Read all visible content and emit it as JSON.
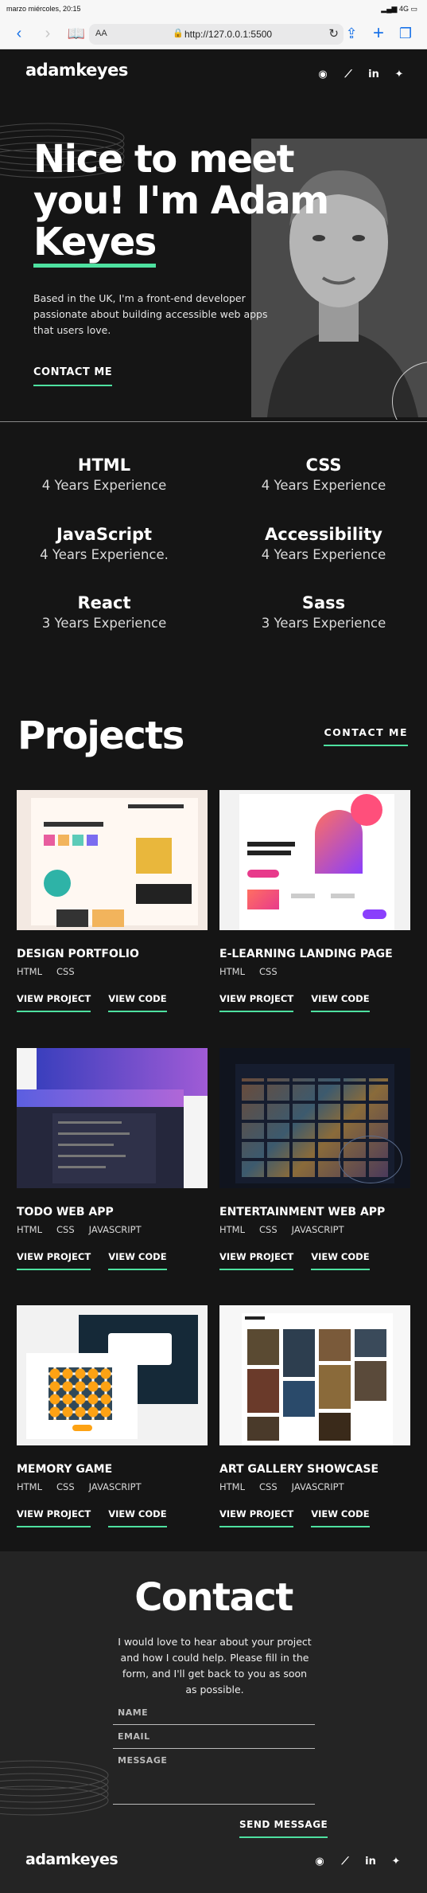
{
  "status": {
    "time": "marzo miércoles, 20:15",
    "signal": "4G"
  },
  "browser": {
    "aa": "AA",
    "url": "http://127.0.0.1:5500"
  },
  "header": {
    "logo": "adamkeyes",
    "socials": [
      {
        "icon": "github-icon",
        "glyph": "◉"
      },
      {
        "icon": "frontendmentor-icon",
        "glyph": "⟋"
      },
      {
        "icon": "linkedin-icon",
        "glyph": "in"
      },
      {
        "icon": "twitter-icon",
        "glyph": "✦"
      }
    ]
  },
  "hero": {
    "title_line1": "Nice to meet",
    "title_line2": "you! I'm Adam",
    "title_name": "Keyes",
    "text": "Based in the UK, I'm a front-end developer passionate about building accessible web apps that users love.",
    "cta": "CONTACT ME"
  },
  "skills": [
    {
      "name": "HTML",
      "exp": "4 Years Experience"
    },
    {
      "name": "CSS",
      "exp": "4 Years Experience"
    },
    {
      "name": "JavaScript",
      "exp": "4 Years Experience."
    },
    {
      "name": "Accessibility",
      "exp": "4 Years Experience"
    },
    {
      "name": "React",
      "exp": "3 Years Experience"
    },
    {
      "name": "Sass",
      "exp": "3 Years Experience"
    }
  ],
  "projects": {
    "title": "Projects",
    "contact": "CONTACT ME",
    "view_project": "VIEW PROJECT",
    "view_code": "VIEW CODE",
    "items": [
      {
        "title": "DESIGN PORTFOLIO",
        "tags": [
          "HTML",
          "CSS"
        ]
      },
      {
        "title": "E-LEARNING LANDING PAGE",
        "tags": [
          "HTML",
          "CSS"
        ]
      },
      {
        "title": "TODO WEB APP",
        "tags": [
          "HTML",
          "CSS",
          "JAVASCRIPT"
        ]
      },
      {
        "title": "ENTERTAINMENT WEB APP",
        "tags": [
          "HTML",
          "CSS",
          "JAVASCRIPT"
        ]
      },
      {
        "title": "MEMORY GAME",
        "tags": [
          "HTML",
          "CSS",
          "JAVASCRIPT"
        ]
      },
      {
        "title": "ART GALLERY SHOWCASE",
        "tags": [
          "HTML",
          "CSS",
          "JAVASCRIPT"
        ]
      }
    ]
  },
  "contact": {
    "title": "Contact",
    "text": "I would love to hear about your project and how I could help. Please fill in the form, and I'll get back to you as soon as possible.",
    "name_placeholder": "NAME",
    "email_placeholder": "EMAIL",
    "message_placeholder": "MESSAGE",
    "send": "SEND MESSAGE"
  },
  "footer": {
    "logo": "adamkeyes"
  },
  "colors": {
    "accent": "#4ee1a0",
    "bg": "#151515",
    "contact_bg": "#242424"
  }
}
